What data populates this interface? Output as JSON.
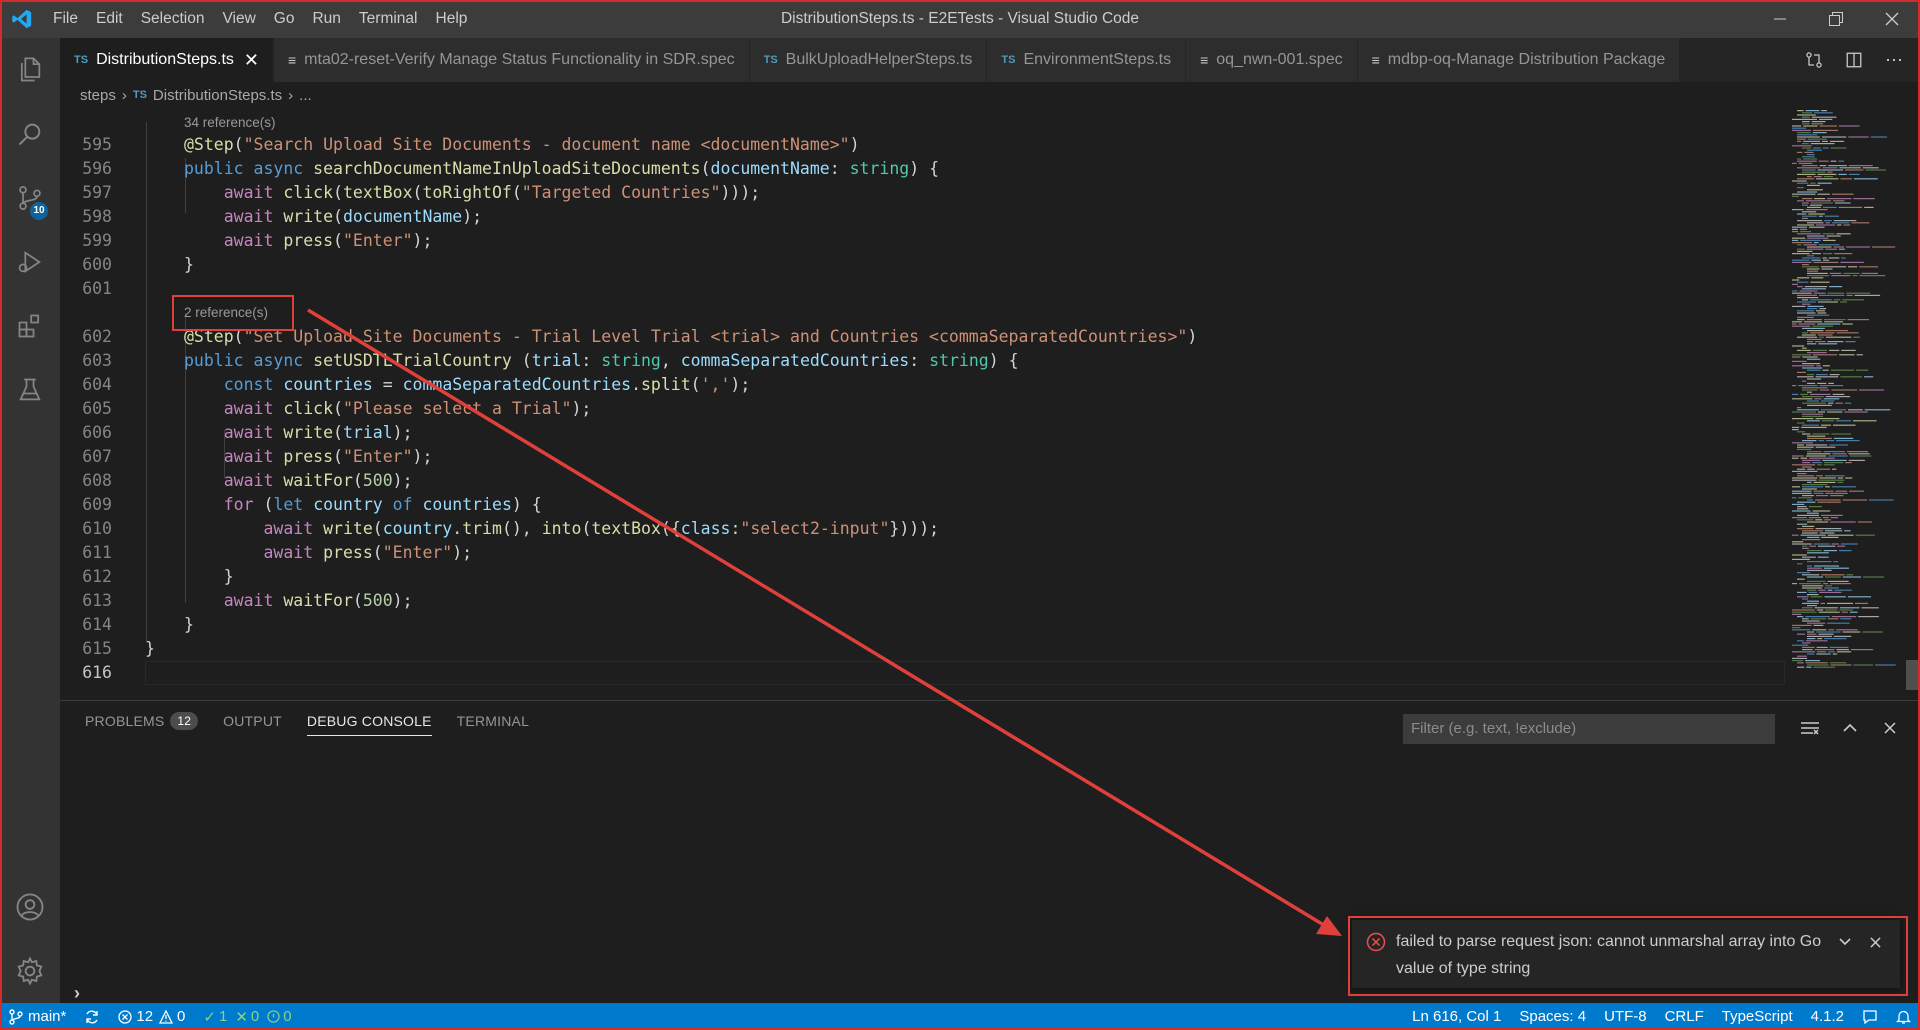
{
  "window": {
    "title": "DistributionSteps.ts - E2ETests - Visual Studio Code",
    "menus": [
      "File",
      "Edit",
      "Selection",
      "View",
      "Go",
      "Run",
      "Terminal",
      "Help"
    ]
  },
  "activity_bar": {
    "icons": [
      "explorer-icon",
      "search-icon",
      "source-control-icon",
      "run-debug-icon",
      "extensions-icon",
      "testing-icon",
      "account-icon",
      "settings-gear-icon"
    ],
    "source_control_badge": "10"
  },
  "tabs": [
    {
      "label": "DistributionSteps.ts",
      "kind": "TS",
      "active": true
    },
    {
      "label": "mta02-reset-Verify Manage Status Functionality in SDR.spec",
      "kind": "spec"
    },
    {
      "label": "BulkUploadHelperSteps.ts",
      "kind": "TS"
    },
    {
      "label": "EnvironmentSteps.ts",
      "kind": "TS"
    },
    {
      "label": "oq_nwn-001.spec",
      "kind": "spec"
    },
    {
      "label": "mdbp-oq-Manage Distribution Package",
      "kind": "spec"
    }
  ],
  "breadcrumb": {
    "folder": "steps",
    "file_kind": "TS",
    "file": "DistributionSteps.ts",
    "ellipsis": "..."
  },
  "editor": {
    "codelens_1": "34 reference(s)",
    "codelens_2": "2 reference(s)",
    "current_line": "616",
    "line_numbers": [
      "595",
      "596",
      "597",
      "598",
      "599",
      "600",
      "601",
      "602",
      "603",
      "604",
      "605",
      "606",
      "607",
      "608",
      "609",
      "610",
      "611",
      "612",
      "613",
      "614",
      "615",
      "616"
    ]
  },
  "panel": {
    "tabs": [
      {
        "label": "PROBLEMS",
        "count": "12"
      },
      {
        "label": "OUTPUT"
      },
      {
        "label": "DEBUG CONSOLE",
        "active": true
      },
      {
        "label": "TERMINAL"
      }
    ],
    "filter_placeholder": "Filter (e.g. text, !exclude)"
  },
  "notification": {
    "message": "failed to parse request json: cannot unmarshal array into Go value of type string",
    "severity": "error"
  },
  "status_bar": {
    "branch": "main*",
    "errors": "12",
    "warnings": "0",
    "checks_pass": "1",
    "checks_fail": "0",
    "checks_info": "0",
    "position": "Ln 616, Col 1",
    "indent": "Spaces: 4",
    "encoding": "UTF-8",
    "eol": "CRLF",
    "language": "TypeScript",
    "version": "4.1.2"
  },
  "colors": {
    "accent": "#007acc",
    "annotation_red": "#e0403b",
    "title_bar": "#3c3c3c",
    "editor_bg": "#1e1e1e"
  }
}
